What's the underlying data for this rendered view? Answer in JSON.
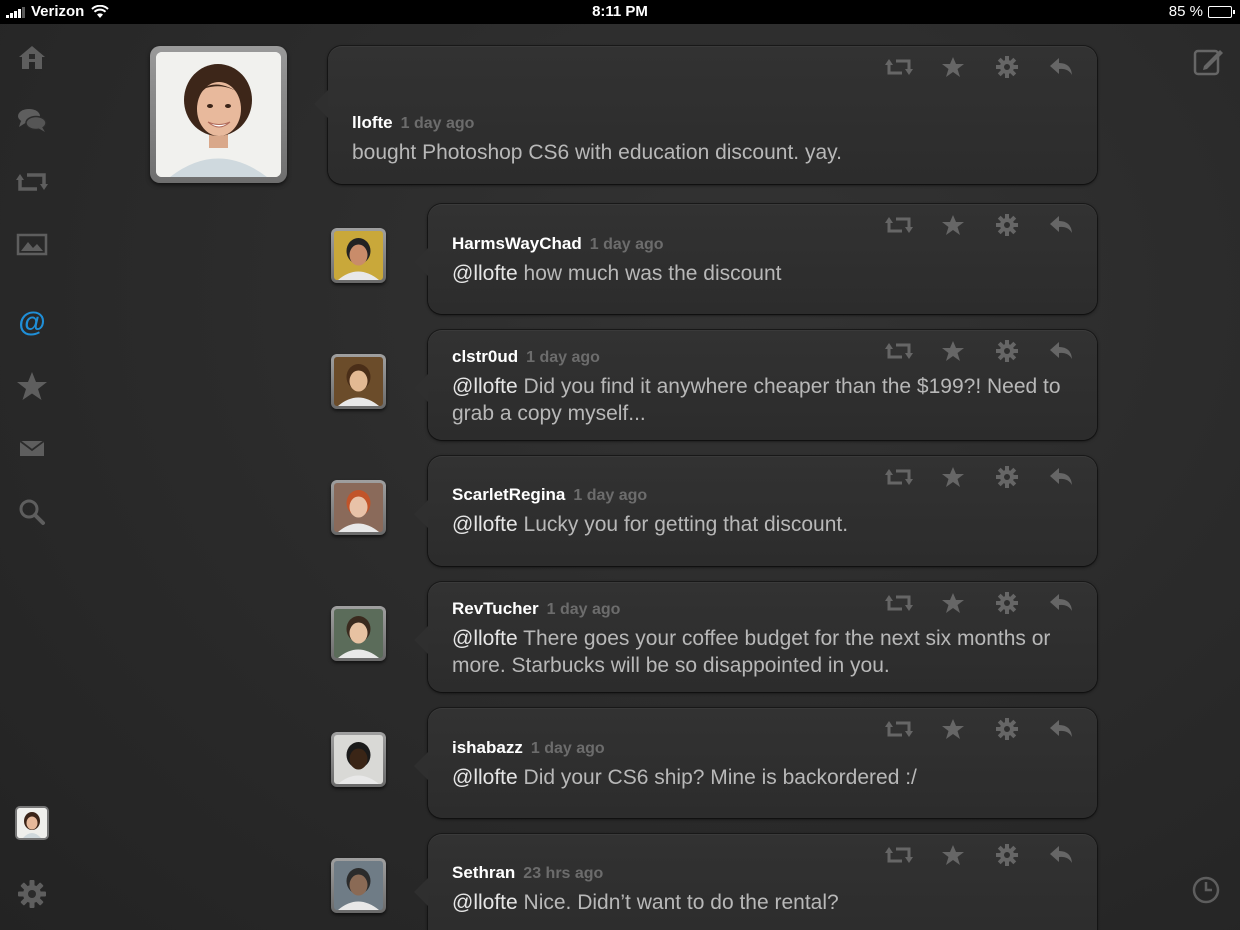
{
  "status_bar": {
    "carrier": "Verizon",
    "time": "8:11 PM",
    "battery_text": "85 %",
    "battery_level": 0.85
  },
  "sidebar": {
    "items": [
      {
        "icon": "home-icon"
      },
      {
        "icon": "conversations-icon"
      },
      {
        "icon": "retweets-icon"
      },
      {
        "icon": "media-icon"
      },
      {
        "icon": "mentions-icon",
        "active": true
      },
      {
        "icon": "favorites-icon"
      },
      {
        "icon": "messages-icon"
      },
      {
        "icon": "search-icon"
      }
    ],
    "bottom": [
      "account-avatar",
      "settings-icon"
    ]
  },
  "colors": {
    "active_accent": "#1f8fd8",
    "icon_gray": "#5e5e5e",
    "bubble": "#2f2f2f",
    "background": "#2b2b2b"
  },
  "main_tweet": {
    "username": "llofte",
    "time": "1 day ago",
    "text": "bought Photoshop CS6 with education discount. yay."
  },
  "replies": [
    {
      "username": "HarmsWayChad",
      "time": "1 day ago",
      "mention": "@llofte",
      "text": " how much was the discount"
    },
    {
      "username": "clstr0ud",
      "time": "1 day ago",
      "mention": "@llofte",
      "text": " Did you find it anywhere cheaper than the $199?! Need to grab a copy myself..."
    },
    {
      "username": "ScarletRegina",
      "time": "1 day ago",
      "mention": "@llofte",
      "text": " Lucky you for getting that discount."
    },
    {
      "username": "RevTucher",
      "time": "1 day ago",
      "mention": "@llofte",
      "text": " There goes your coffee budget for the next six months or more. Starbucks will be so disappointed in you."
    },
    {
      "username": "ishabazz",
      "time": "1 day ago",
      "mention": "@llofte",
      "text": " Did your CS6 ship?  Mine is backordered :/"
    },
    {
      "username": "Sethran",
      "time": "23 hrs ago",
      "mention": "@llofte",
      "text": " Nice. Didn’t want to do the rental?"
    }
  ],
  "tweet_actions": [
    "retweet-icon",
    "favorite-icon",
    "gear-icon",
    "reply-icon"
  ],
  "top_right": "compose-icon",
  "bottom_right": "clock-icon"
}
